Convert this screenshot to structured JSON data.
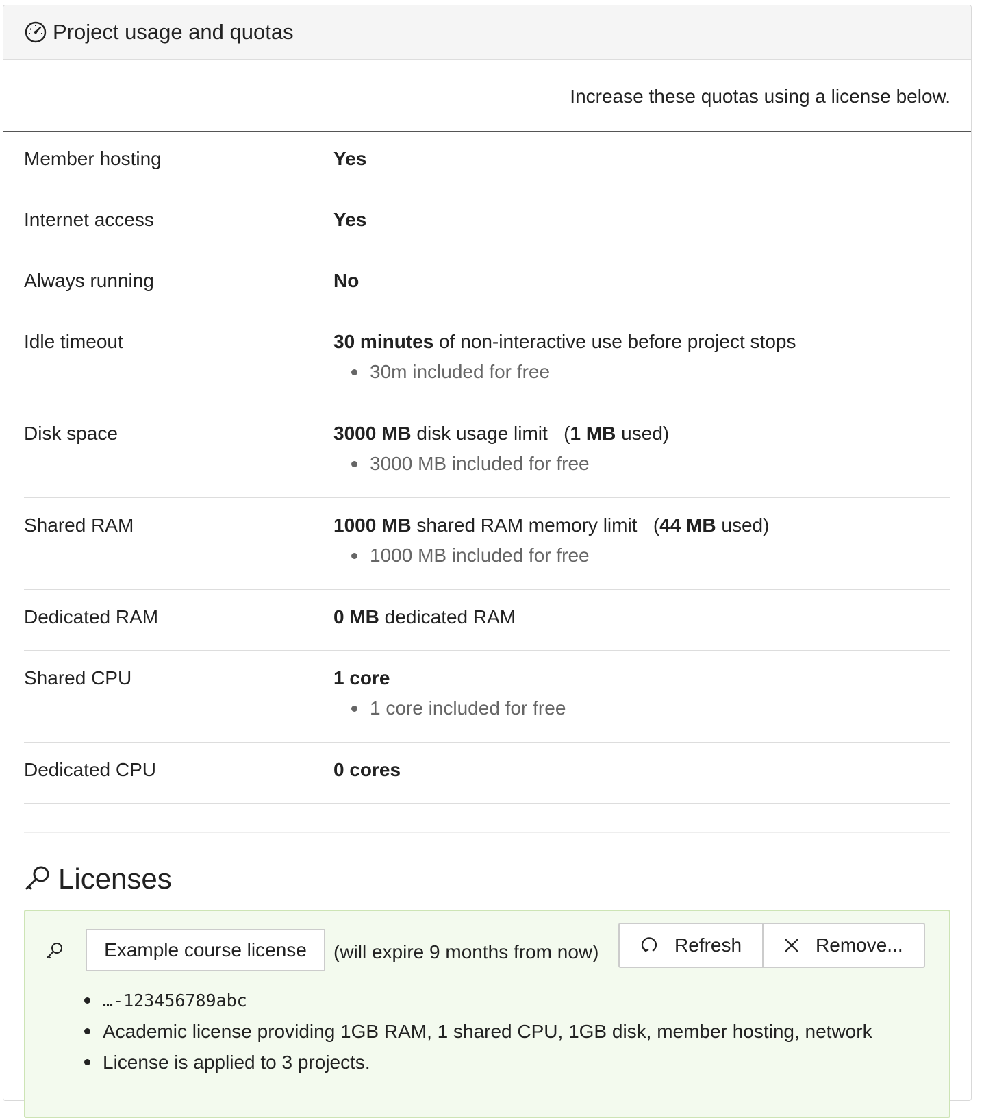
{
  "panel": {
    "title": "Project usage and quotas",
    "icon": "dashboard-icon",
    "note": "Increase these quotas using a license below."
  },
  "quotas": [
    {
      "label": "Member hosting",
      "value_bold": "Yes",
      "value_rest": "",
      "used_bold": "",
      "sub": ""
    },
    {
      "label": "Internet access",
      "value_bold": "Yes",
      "value_rest": "",
      "used_bold": "",
      "sub": ""
    },
    {
      "label": "Always running",
      "value_bold": "No",
      "value_rest": "",
      "used_bold": "",
      "sub": ""
    },
    {
      "label": "Idle timeout",
      "value_bold": "30 minutes",
      "value_rest": " of non-interactive use before project stops",
      "used_bold": "",
      "sub": "30m included for free"
    },
    {
      "label": "Disk space",
      "value_bold": "3000 MB",
      "value_rest": " disk usage limit",
      "used_bold": "1 MB",
      "sub": "3000 MB included for free"
    },
    {
      "label": "Shared RAM",
      "value_bold": "1000 MB",
      "value_rest": " shared RAM memory limit",
      "used_bold": "44 MB",
      "sub": "1000 MB included for free"
    },
    {
      "label": "Dedicated RAM",
      "value_bold": "0 MB",
      "value_rest": " dedicated RAM",
      "used_bold": "",
      "sub": ""
    },
    {
      "label": "Shared CPU",
      "value_bold": "1 core",
      "value_rest": "",
      "used_bold": "",
      "sub": "1 core included for free"
    },
    {
      "label": "Dedicated CPU",
      "value_bold": "0 cores",
      "value_rest": "",
      "used_bold": "",
      "sub": ""
    }
  ],
  "used_open": "(",
  "used_close": " used)",
  "licenses": {
    "title": "Licenses",
    "icon": "key-icon",
    "item": {
      "name": "Example course license",
      "expiry": "(will expire 9 months from now)",
      "refresh_label": "Refresh",
      "remove_label": "Remove...",
      "key_suffix": "…-123456789abc",
      "description": "Academic license providing 1GB RAM, 1 shared CPU, 1GB disk, member hosting, network",
      "applied": "License is applied to 3 projects."
    }
  },
  "colors": {
    "license_bg": "#f3faee",
    "license_border": "#cde4b5",
    "header_bg": "#f5f5f5"
  }
}
